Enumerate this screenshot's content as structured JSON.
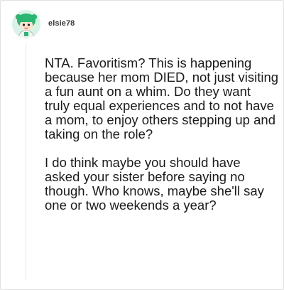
{
  "comment": {
    "username": "elsie78",
    "avatar_icon": "cartoon-character-avatar-icon",
    "paragraphs": [
      "NTA. Favoritism? This is happening because her mom DIED, not just visiting a fun aunt on a whim. Do they want truly equal experiences and to not have a mom, to enjoy others stepping up and taking on the role?",
      "I do think maybe you should have asked your sister before saying no though. Who knows, maybe she'll say one or two weekends a year?"
    ]
  },
  "colors": {
    "avatar_bg": "#d9f3e6",
    "avatar_hair": "#2bb673",
    "text": "#1b1b1b",
    "border": "#e2e2e2"
  }
}
